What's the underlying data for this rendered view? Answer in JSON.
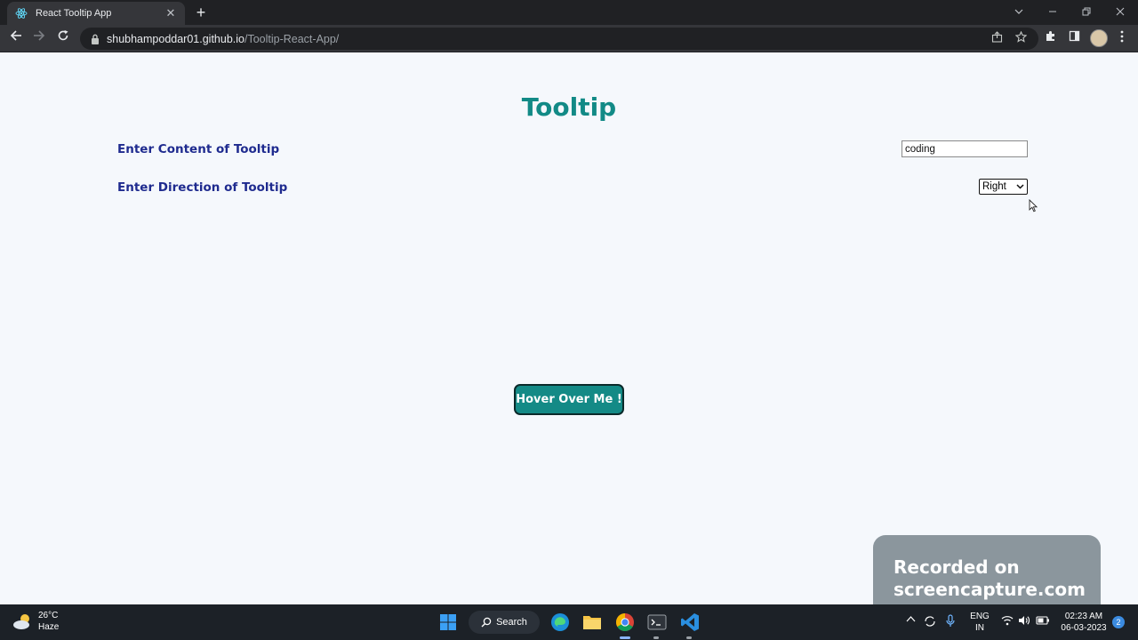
{
  "browser": {
    "tab_title": "React Tooltip App",
    "tab_close": "✕",
    "new_tab": "+",
    "url_domain": "shubhampoddar01.github.io",
    "url_path": "/Tooltip-React-App/"
  },
  "page": {
    "title": "Tooltip",
    "content_label": "Enter Content of Tooltip",
    "content_value": "coding",
    "direction_label": "Enter Direction of Tooltip",
    "direction_selected": "Right",
    "hover_button_label": "Hover Over Me !",
    "accent_color": "#128a86",
    "label_color": "#1f2b8f"
  },
  "watermark": {
    "line1": "Recorded on",
    "line2": "screencapture.com"
  },
  "taskbar": {
    "weather_temp": "26°C",
    "weather_desc": "Haze",
    "search_label": "Search",
    "lang_line1": "ENG",
    "lang_line2": "IN",
    "time": "02:23 AM",
    "date": "06-03-2023",
    "notification_count": "2"
  }
}
